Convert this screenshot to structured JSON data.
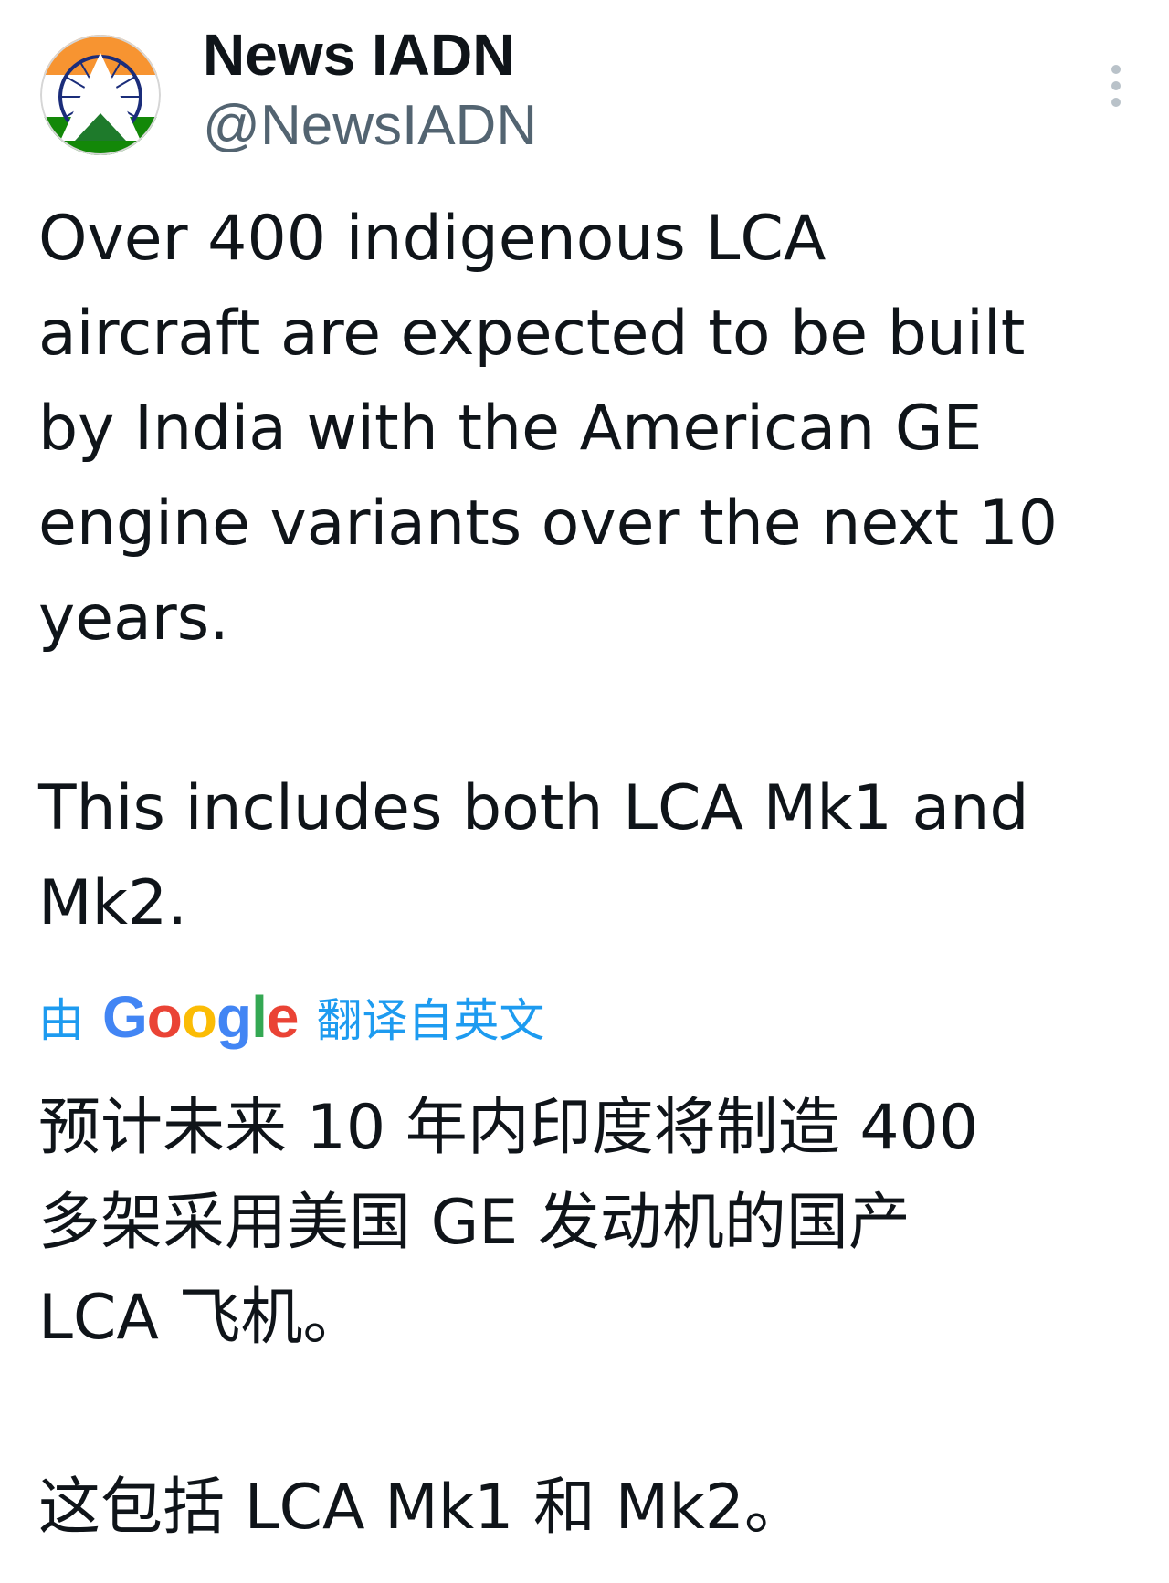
{
  "author": {
    "name": "News IADN",
    "handle": "@NewsIADN",
    "avatar_icon": "india-flag-triangle-avatar"
  },
  "menu": {
    "icon": "more-vertical-icon"
  },
  "tweet": {
    "paragraph_1": "Over 400 indigenous LCA\naircraft are expected to be built\nby India with the American GE\nengine variants over the next 10\nyears.",
    "paragraph_2": "This includes both LCA Mk1 and\nMk2."
  },
  "translation_label": {
    "prefix": "由",
    "brand_letters": [
      "G",
      "o",
      "o",
      "g",
      "l",
      "e"
    ],
    "suffix": "翻译自英文"
  },
  "translation": {
    "paragraph_1": "预计未来 10 年内印度将制造 400\n多架采用美国 GE 发动机的国产\nLCA 飞机。",
    "paragraph_2": "这包括 LCA Mk1 和 Mk2。"
  },
  "colors": {
    "text_primary": "#0f1419",
    "text_secondary": "#536471",
    "link_blue": "#1d9bf0",
    "google_blue": "#4285f4",
    "google_red": "#ea4335",
    "google_yellow": "#fbbc05",
    "google_green": "#34a853",
    "saffron": "#f79431",
    "india_green": "#138808",
    "chakra_navy": "#1b2d7a"
  }
}
